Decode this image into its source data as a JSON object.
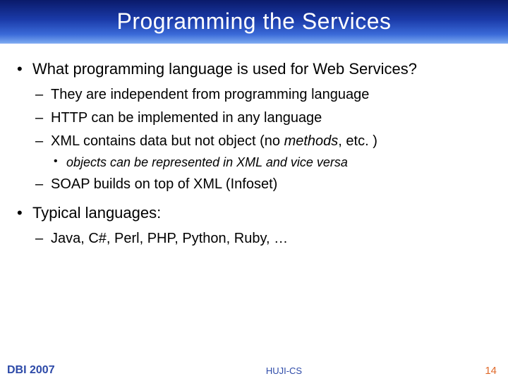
{
  "title": "Programming the Services",
  "bullets": [
    {
      "text": "What programming language is used for Web Services?",
      "children": [
        {
          "text": "They are independent from programming language"
        },
        {
          "text": "HTTP can be implemented in any language"
        },
        {
          "text_html": "XML contains data but not object (no <span class='em'>methods</span>, etc. )",
          "children": [
            {
              "text": "objects can be represented in XML and vice versa"
            }
          ]
        },
        {
          "text": "SOAP builds on top of XML (Infoset)"
        }
      ]
    },
    {
      "text": "Typical languages:",
      "children": [
        {
          "text": "Java, C#, Perl, PHP, Python, Ruby, …"
        }
      ]
    }
  ],
  "footer": {
    "left": "DBI 2007",
    "center": "HUJI-CS",
    "right": "14"
  }
}
